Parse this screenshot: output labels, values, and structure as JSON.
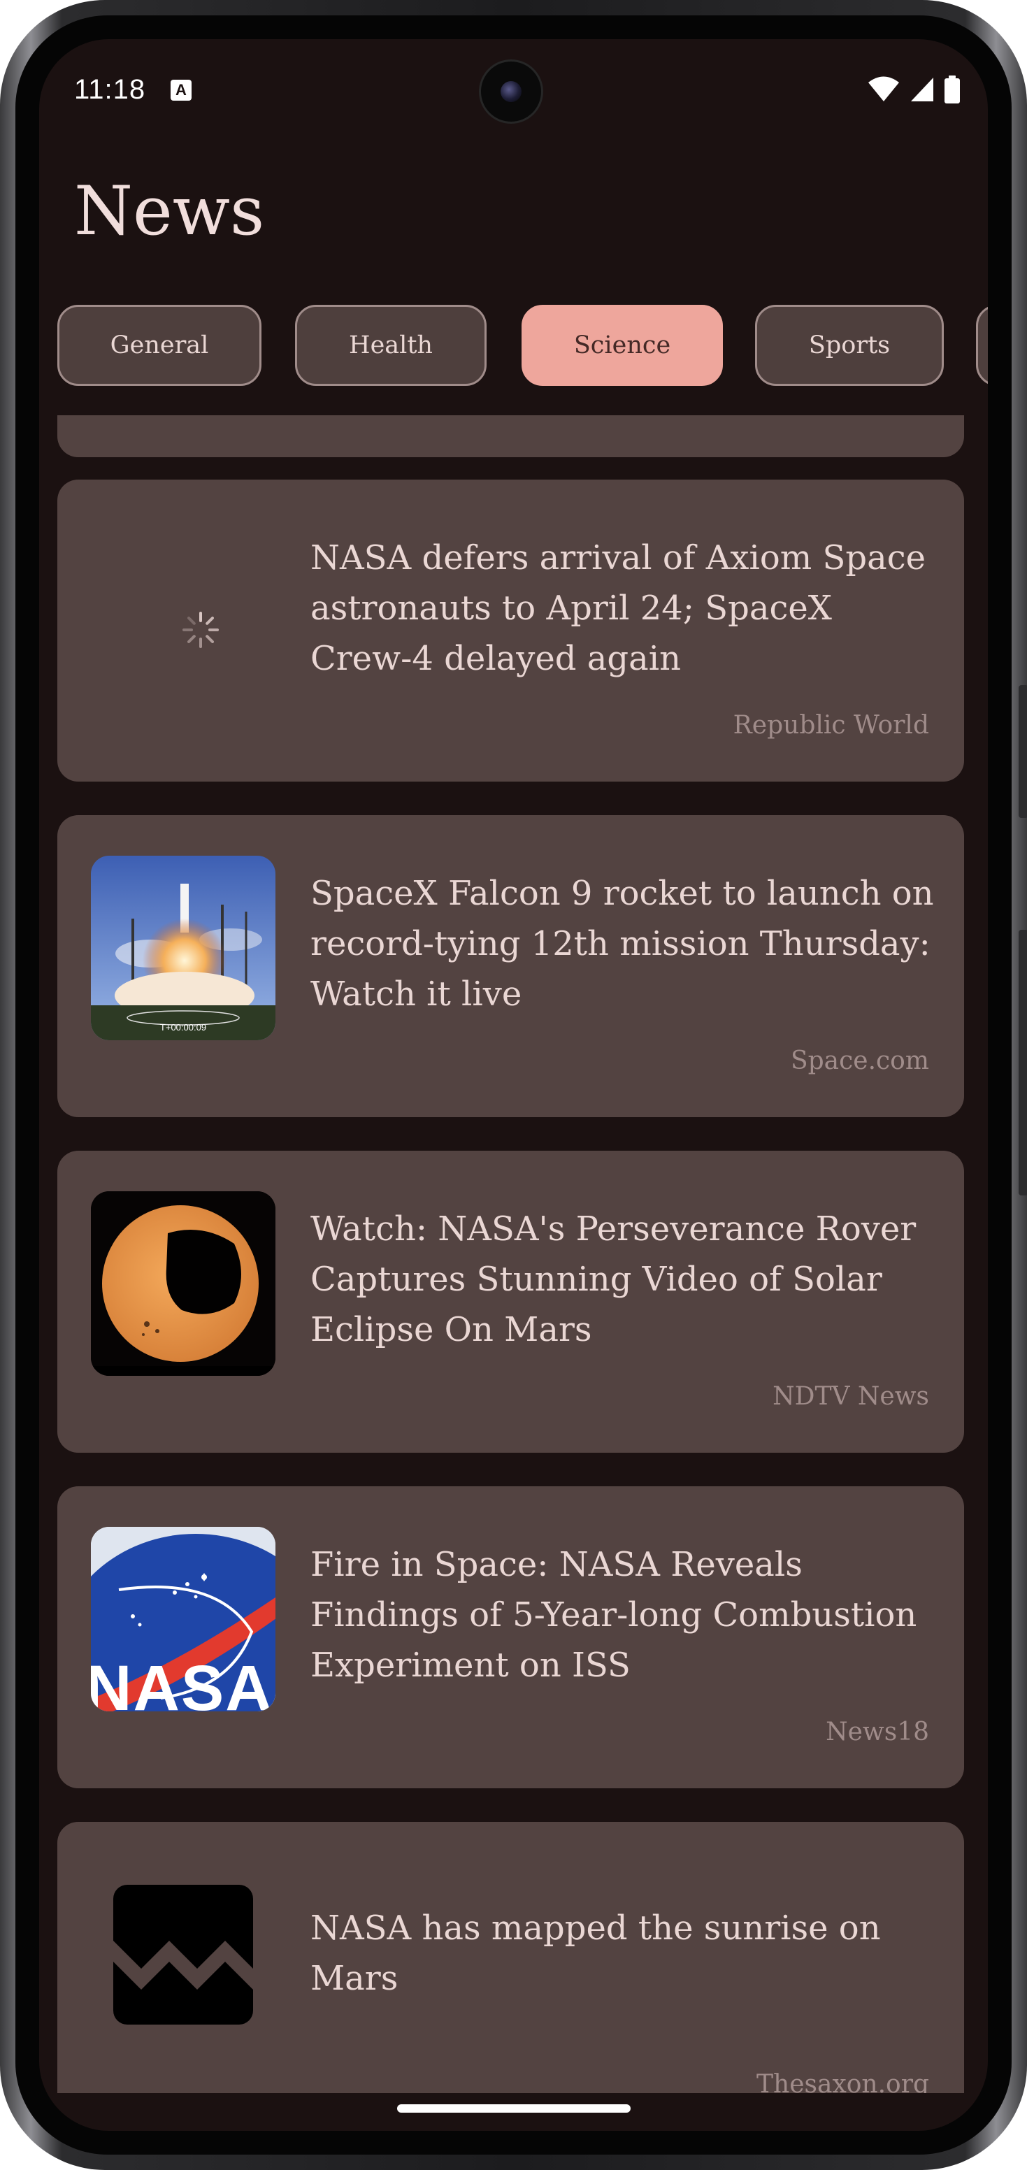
{
  "status_bar": {
    "time": "11:18",
    "notification_icon": "a-icon",
    "wifi_icon": "wifi-icon",
    "signal_icon": "signal-icon",
    "battery_icon": "battery-icon"
  },
  "header": {
    "title": "News"
  },
  "categories": [
    {
      "label": "General",
      "selected": false
    },
    {
      "label": "Health",
      "selected": false
    },
    {
      "label": "Science",
      "selected": true
    },
    {
      "label": "Sports",
      "selected": false
    }
  ],
  "articles": [
    {
      "title": "NASA defers arrival of Axiom Space astronauts to April 24; SpaceX Crew-4 delayed again",
      "source": "Republic World",
      "image": "loading-spinner"
    },
    {
      "title": "SpaceX Falcon 9 rocket to launch on record-tying 12th mission Thursday: Watch it live",
      "source": "Space.com",
      "image": "rocket-launch-thumbnail",
      "image_caption": "T+00:00:09"
    },
    {
      "title": "Watch: NASA's Perseverance Rover Captures Stunning Video of Solar Eclipse On Mars",
      "source": "NDTV News",
      "image": "solar-eclipse-thumbnail"
    },
    {
      "title": "Fire in Space: NASA Reveals Findings of 5-Year-long Combustion Experiment on ISS",
      "source": "News18",
      "image": "nasa-logo-thumbnail",
      "image_caption": "NASA"
    },
    {
      "title": "NASA has mapped the sunrise on Mars",
      "source": "Thesaxon.org",
      "image": "broken-image-icon"
    }
  ],
  "colors": {
    "background": "#1b1111",
    "card": "#534341",
    "chip_selected": "#eea69c",
    "text": "#ead7d4",
    "source_text": "#a08c8a"
  }
}
